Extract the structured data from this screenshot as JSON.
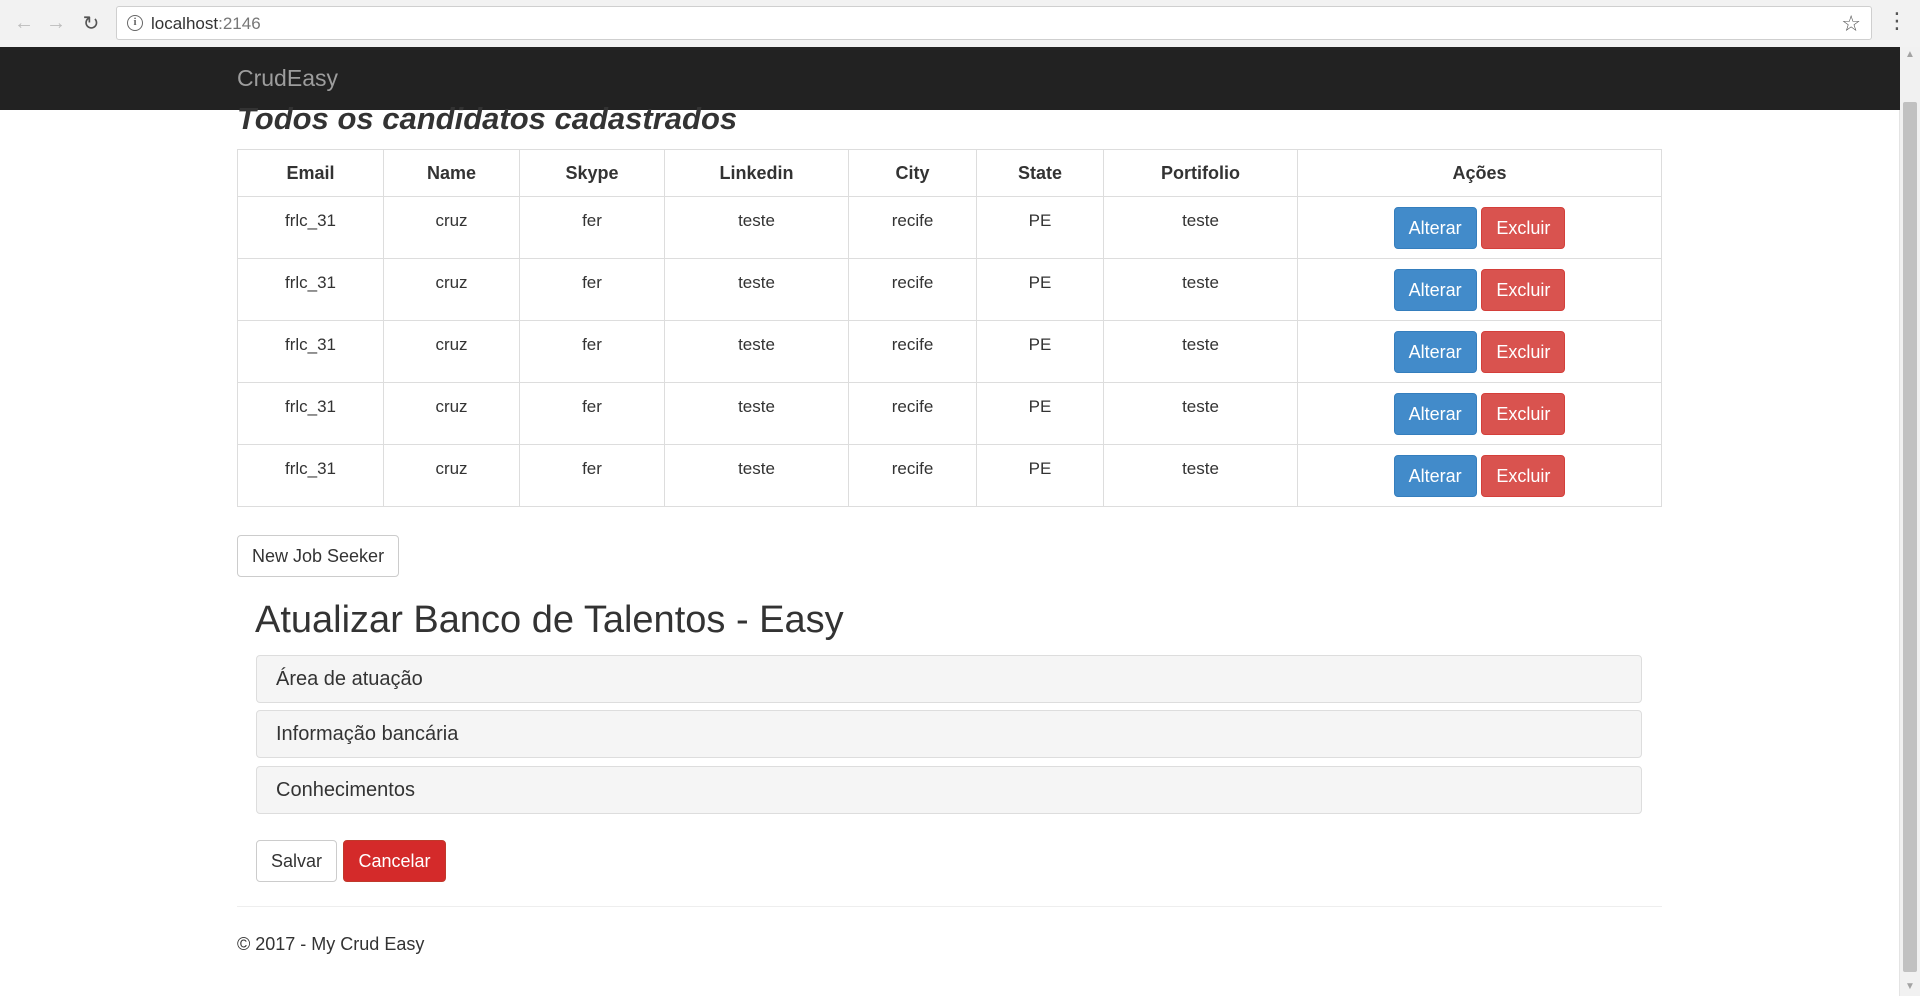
{
  "browser": {
    "url_host": "localhost",
    "url_port": ":2146"
  },
  "navbar": {
    "brand": "CrudEasy"
  },
  "candidates": {
    "heading": "Todos os candidatos cadastrados",
    "columns": [
      "Email",
      "Name",
      "Skype",
      "Linkedin",
      "City",
      "State",
      "Portifolio",
      "Ações"
    ],
    "rows": [
      {
        "email": "frlc_31",
        "name": "cruz",
        "skype": "fer",
        "linkedin": "teste",
        "city": "recife",
        "state": "PE",
        "portfolio": "teste"
      },
      {
        "email": "frlc_31",
        "name": "cruz",
        "skype": "fer",
        "linkedin": "teste",
        "city": "recife",
        "state": "PE",
        "portfolio": "teste"
      },
      {
        "email": "frlc_31",
        "name": "cruz",
        "skype": "fer",
        "linkedin": "teste",
        "city": "recife",
        "state": "PE",
        "portfolio": "teste"
      },
      {
        "email": "frlc_31",
        "name": "cruz",
        "skype": "fer",
        "linkedin": "teste",
        "city": "recife",
        "state": "PE",
        "portfolio": "teste"
      },
      {
        "email": "frlc_31",
        "name": "cruz",
        "skype": "fer",
        "linkedin": "teste",
        "city": "recife",
        "state": "PE",
        "portfolio": "teste"
      }
    ],
    "edit_label": "Alterar",
    "delete_label": "Excluir",
    "new_button": "New Job Seeker"
  },
  "talent_form": {
    "title": "Atualizar Banco de Talentos - Easy",
    "panels": [
      "Área de atuação",
      "Informação bancária",
      "Conhecimentos"
    ],
    "save_label": "Salvar",
    "cancel_label": "Cancelar"
  },
  "footer": {
    "text": "© 2017 - My Crud Easy"
  },
  "colors": {
    "navbar_bg": "#222222",
    "primary": "#428bca",
    "danger": "#d9534f",
    "cancel": "#d42a2a"
  },
  "icons": [
    "back-arrow-icon",
    "forward-arrow-icon",
    "reload-icon",
    "info-icon",
    "star-icon",
    "kebab-menu-icon"
  ]
}
